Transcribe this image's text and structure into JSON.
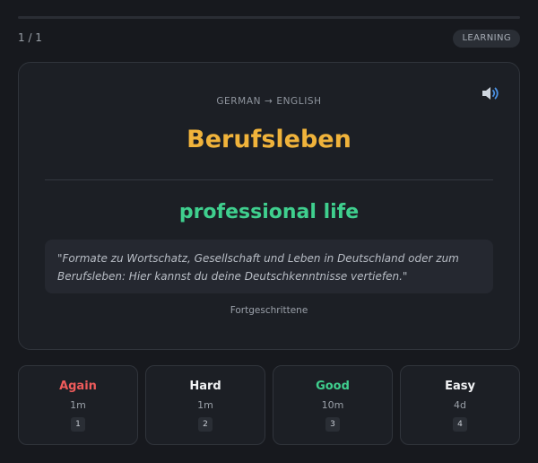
{
  "progress": {
    "label": "1 / 1",
    "fraction": 0
  },
  "status_badge": "LEARNING",
  "card": {
    "language_pair": "GERMAN → ENGLISH",
    "word": "Berufsleben",
    "translation": "professional life",
    "example": "\"Formate zu Wortschatz, Gesellschaft und Leben in Deutschland oder zum Berufsleben: Hier kannst du deine Deutschkenntnisse vertiefen.\"",
    "level": "Fortgeschrittene",
    "speaker_icon": "speaker-icon"
  },
  "grades": [
    {
      "label": "Again",
      "interval": "1m",
      "key": "1",
      "color": "#ef5b5b"
    },
    {
      "label": "Hard",
      "interval": "1m",
      "key": "2",
      "color": "#f2f3f5"
    },
    {
      "label": "Good",
      "interval": "10m",
      "key": "3",
      "color": "#3fcf8e"
    },
    {
      "label": "Easy",
      "interval": "4d",
      "key": "4",
      "color": "#f2f3f5"
    }
  ],
  "colors": {
    "word": "#f0b33b",
    "translation": "#3fcf8e",
    "background": "#17191e",
    "card": "#1c1f25"
  }
}
